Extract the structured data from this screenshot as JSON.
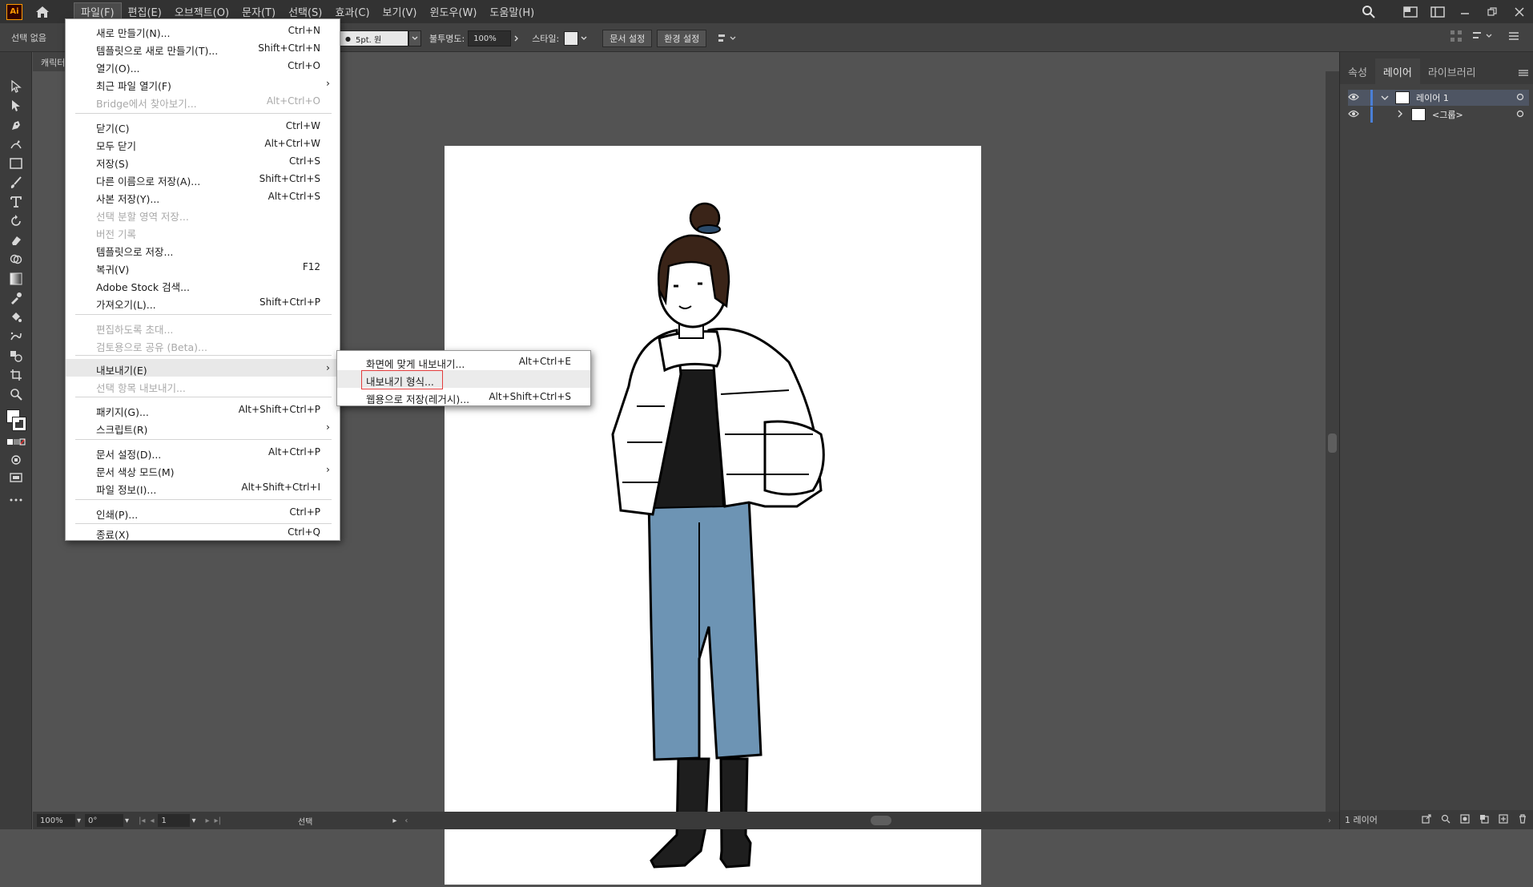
{
  "app": {
    "logo_text": "Ai"
  },
  "menubar": {
    "items": [
      "파일(F)",
      "편집(E)",
      "오브젝트(O)",
      "문자(T)",
      "선택(S)",
      "효과(C)",
      "보기(V)",
      "윈도우(W)",
      "도움말(H)"
    ]
  },
  "controlbar": {
    "selection": "선택 없음",
    "stroke": "5pt. 원",
    "opacity_label": "불투명도:",
    "opacity_value": "100%",
    "style_label": "스타일:",
    "doc_setup": "문서 설정",
    "prefs": "환경 설정"
  },
  "doc_tab": {
    "label": "캐릭터"
  },
  "file_menu": {
    "items": [
      {
        "label": "새로 만들기(N)...",
        "shortcut": "Ctrl+N"
      },
      {
        "label": "템플릿으로 새로 만들기(T)...",
        "shortcut": "Shift+Ctrl+N"
      },
      {
        "label": "열기(O)...",
        "shortcut": "Ctrl+O"
      },
      {
        "label": "최근 파일 열기(F)",
        "shortcut": ""
      },
      {
        "label": "Bridge에서 찾아보기...",
        "shortcut": "Alt+Ctrl+O"
      },
      {
        "label": "닫기(C)",
        "shortcut": "Ctrl+W"
      },
      {
        "label": "모두 닫기",
        "shortcut": "Alt+Ctrl+W"
      },
      {
        "label": "저장(S)",
        "shortcut": "Ctrl+S"
      },
      {
        "label": "다른 이름으로 저장(A)...",
        "shortcut": "Shift+Ctrl+S"
      },
      {
        "label": "사본 저장(Y)...",
        "shortcut": "Alt+Ctrl+S"
      },
      {
        "label": "선택 분할 영역 저장...",
        "shortcut": ""
      },
      {
        "label": "버전 기록",
        "shortcut": ""
      },
      {
        "label": "템플릿으로 저장...",
        "shortcut": ""
      },
      {
        "label": "복귀(V)",
        "shortcut": "F12"
      },
      {
        "label": "Adobe Stock 검색...",
        "shortcut": ""
      },
      {
        "label": "가져오기(L)...",
        "shortcut": "Shift+Ctrl+P"
      },
      {
        "label": "편집하도록 초대...",
        "shortcut": ""
      },
      {
        "label": "검토용으로 공유 (Beta)...",
        "shortcut": ""
      },
      {
        "label": "내보내기(E)",
        "shortcut": ""
      },
      {
        "label": "선택 항목 내보내기...",
        "shortcut": ""
      },
      {
        "label": "패키지(G)...",
        "shortcut": "Alt+Shift+Ctrl+P"
      },
      {
        "label": "스크립트(R)",
        "shortcut": ""
      },
      {
        "label": "문서 설정(D)...",
        "shortcut": "Alt+Ctrl+P"
      },
      {
        "label": "문서 색상 모드(M)",
        "shortcut": ""
      },
      {
        "label": "파일 정보(I)...",
        "shortcut": "Alt+Shift+Ctrl+I"
      },
      {
        "label": "인쇄(P)...",
        "shortcut": "Ctrl+P"
      },
      {
        "label": "종료(X)",
        "shortcut": "Ctrl+Q"
      }
    ]
  },
  "export_submenu": {
    "items": [
      {
        "label": "화면에 맞게 내보내기...",
        "shortcut": "Alt+Ctrl+E"
      },
      {
        "label": "내보내기 형식...",
        "shortcut": ""
      },
      {
        "label": "웹용으로 저장(레거시)...",
        "shortcut": "Alt+Shift+Ctrl+S"
      }
    ]
  },
  "right_panel": {
    "tabs": [
      "속성",
      "레이어",
      "라이브러리"
    ],
    "layers": [
      {
        "name": "레이어 1"
      },
      {
        "name": "<그룹>"
      }
    ],
    "footer": "1 레이어"
  },
  "statusbar": {
    "zoom": "100%",
    "rotation": "0°",
    "artboard": "1",
    "tool": "선택"
  },
  "colors": {
    "menu_bg": "#323232",
    "panel_bg": "#424242",
    "canvas_bg": "#535353",
    "highlight_box": "#e23c3c",
    "layer_accent": "#4a7fd6"
  }
}
